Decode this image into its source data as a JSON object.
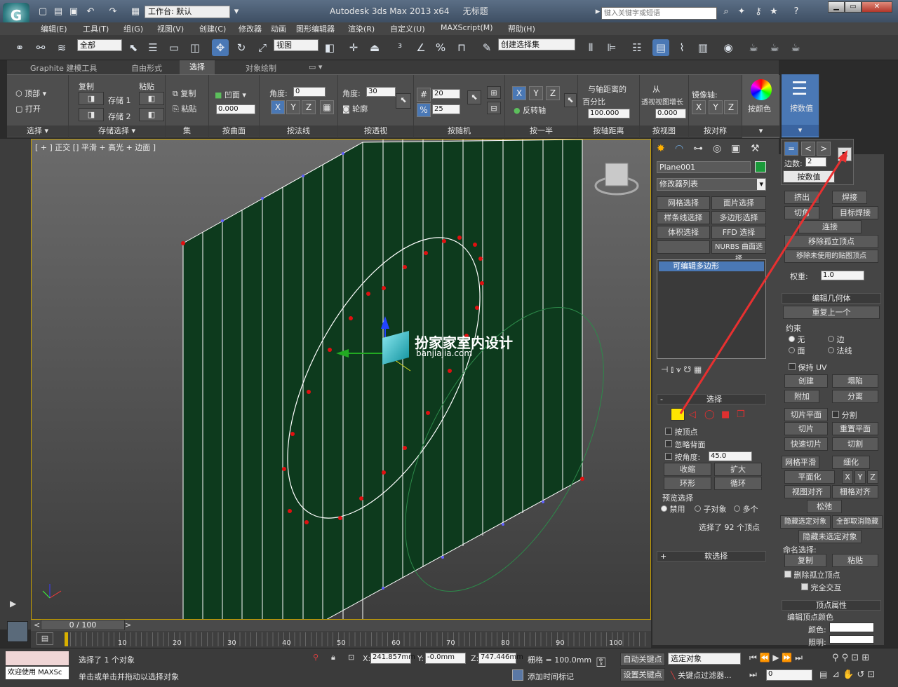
{
  "titlebar": {
    "workspace": "工作台: 默认",
    "app_title": "Autodesk 3ds Max  2013 x64",
    "doc_title": "无标题",
    "search_placeholder": "键入关键字或短语",
    "logo": "G"
  },
  "menus": [
    "编辑(E)",
    "工具(T)",
    "组(G)",
    "视图(V)",
    "创建(C)",
    "修改器",
    "动画",
    "图形编辑器",
    "渲染(R)",
    "自定义(U)",
    "MAXScript(M)",
    "帮助(H)"
  ],
  "toolbar": {
    "filter": "全部",
    "coord": "视图",
    "named_sel": "创建选择集"
  },
  "ribbon_tabs": [
    "Graphite 建模工具",
    "自由形式",
    "选择",
    "对象绘制"
  ],
  "ribbon": {
    "g_select": {
      "label": "选择",
      "top": "顶部",
      "open": "打开"
    },
    "g_store": {
      "label": "存储选择",
      "copy": "复制",
      "paste": "粘贴",
      "store1": "存储 1",
      "store2": "存储 2"
    },
    "g_set": {
      "label": "集",
      "copy": "复制",
      "paste": "粘贴"
    },
    "g_concave": {
      "label": "按曲面",
      "concave": "凹面",
      "value": "0.000"
    },
    "g_normal": {
      "label": "按法线",
      "angle": "角度:",
      "value": "0"
    },
    "g_persp": {
      "label": "按透视",
      "angle": "角度:",
      "value": "30",
      "outline": "轮廓"
    },
    "g_random": {
      "label": "按随机",
      "v1": "20",
      "v2": "25"
    },
    "g_half": {
      "label": "按一半",
      "invert": "反转轴"
    },
    "g_dist": {
      "label": "按轴距离",
      "l1": "与轴距离的",
      "l2": "百分比",
      "value": "100.000"
    },
    "g_view": {
      "label": "按视图",
      "l1": "从",
      "l2": "透视视图增长",
      "value": "0.000"
    },
    "g_sym": {
      "label": "按对称",
      "mirror": "镜像轴:"
    },
    "g_color": {
      "label": "按颜色"
    },
    "g_numeric": {
      "label": "按数值"
    }
  },
  "viewport": {
    "label": "[ + ] 正交 [] 平滑 + 高光 + 边面 ]",
    "watermark": "扮家家室内设计",
    "watermark_url": "banjiajia.com"
  },
  "timeline": {
    "frame": "0 / 100",
    "ticks": [
      "10",
      "20",
      "30",
      "40",
      "50",
      "60",
      "70",
      "80",
      "90",
      "100"
    ]
  },
  "cmdpanel": {
    "object_name": "Plane001",
    "modifier_list": "修改器列表",
    "mod_buttons": [
      "网格选择",
      "面片选择",
      "样条线选择",
      "多边形选择",
      "体积选择",
      "FFD 选择",
      "",
      "NURBS 曲面选择"
    ],
    "stack_item": "可编辑多边形",
    "select_title": "选择",
    "by_vertex": "按顶点",
    "ignore_back": "忽略背面",
    "by_angle": "按角度:",
    "angle_value": "45.0",
    "shrink": "收缩",
    "grow": "扩大",
    "ring": "环形",
    "loop": "循环",
    "preview_title": "预览选择",
    "disable": "禁用",
    "subobj": "子对象",
    "multi": "多个",
    "selected_info": "选择了 92 个顶点",
    "soft": "软选择"
  },
  "flyout": {
    "edges_label": "边数:",
    "edges_value": "2",
    "tooltip": "按数值"
  },
  "rpanel": {
    "top_row": [
      "挤出",
      "焊接",
      "切角",
      "目标焊接",
      "连接",
      "移除孤立顶点",
      "移除未使用的贴图顶点"
    ],
    "weight": "权重:",
    "weight_value": "1.0",
    "edit_geo": "编辑几何体",
    "repeat": "重复上一个",
    "constraint": "约束",
    "none": "无",
    "edge": "边",
    "face": "面",
    "normal": "法线",
    "keep_uv": "保持 UV",
    "create": "创建",
    "collapse": "塌陷",
    "attach": "附加",
    "detach": "分离",
    "slice_plane": "切片平面",
    "split": "分割",
    "slice": "切片",
    "reset_plane": "重置平面",
    "quick_slice": "快速切片",
    "cut": "切割",
    "meshsmooth": "网格平滑",
    "tessellate": "细化",
    "planarize": "平面化",
    "view_align": "视图对齐",
    "grid_align": "栅格对齐",
    "relax": "松弛",
    "hide_sel": "隐藏选定对象",
    "unhide_all": "全部取消隐藏",
    "hide_unsel": "隐藏未选定对象",
    "named_sel": "命名选择:",
    "copy": "复制",
    "paste": "粘贴",
    "delete_iso": "删除孤立顶点",
    "full_interact": "完全交互",
    "vertex_props": "顶点属性",
    "edit_vcolor": "编辑顶点颜色",
    "color": "颜色:",
    "illum": "照明:"
  },
  "status": {
    "welcome": "欢迎使用 MAXSc",
    "selected": "选择了 1 个对象",
    "hint": "单击或单击并拖动以选择对象",
    "x": "241.857mm",
    "y": "-0.0mm",
    "z": "747.446mm",
    "grid": "栅格 = 100.0mm",
    "autokey": "自动关键点",
    "setkey": "设置关键点",
    "sel_obj": "选定对象",
    "key_filter": "关键点过滤器...",
    "add_time": "添加时间标记",
    "frame": "0"
  }
}
